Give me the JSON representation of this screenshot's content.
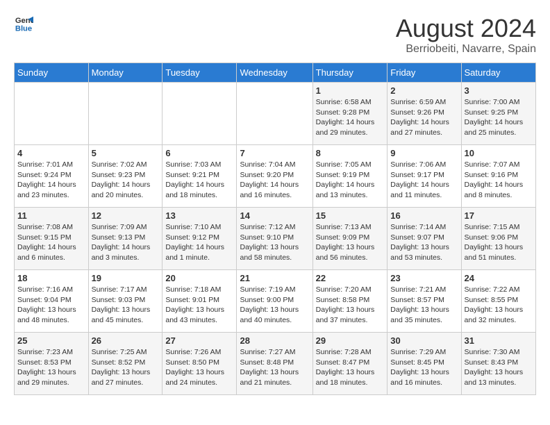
{
  "logo": {
    "text_general": "General",
    "text_blue": "Blue"
  },
  "header": {
    "month_year": "August 2024",
    "location": "Berriobeiti, Navarre, Spain"
  },
  "weekdays": [
    "Sunday",
    "Monday",
    "Tuesday",
    "Wednesday",
    "Thursday",
    "Friday",
    "Saturday"
  ],
  "weeks": [
    [
      {
        "day": "",
        "sunrise": "",
        "sunset": "",
        "daylight": ""
      },
      {
        "day": "",
        "sunrise": "",
        "sunset": "",
        "daylight": ""
      },
      {
        "day": "",
        "sunrise": "",
        "sunset": "",
        "daylight": ""
      },
      {
        "day": "",
        "sunrise": "",
        "sunset": "",
        "daylight": ""
      },
      {
        "day": "1",
        "sunrise": "Sunrise: 6:58 AM",
        "sunset": "Sunset: 9:28 PM",
        "daylight": "Daylight: 14 hours and 29 minutes."
      },
      {
        "day": "2",
        "sunrise": "Sunrise: 6:59 AM",
        "sunset": "Sunset: 9:26 PM",
        "daylight": "Daylight: 14 hours and 27 minutes."
      },
      {
        "day": "3",
        "sunrise": "Sunrise: 7:00 AM",
        "sunset": "Sunset: 9:25 PM",
        "daylight": "Daylight: 14 hours and 25 minutes."
      }
    ],
    [
      {
        "day": "4",
        "sunrise": "Sunrise: 7:01 AM",
        "sunset": "Sunset: 9:24 PM",
        "daylight": "Daylight: 14 hours and 23 minutes."
      },
      {
        "day": "5",
        "sunrise": "Sunrise: 7:02 AM",
        "sunset": "Sunset: 9:23 PM",
        "daylight": "Daylight: 14 hours and 20 minutes."
      },
      {
        "day": "6",
        "sunrise": "Sunrise: 7:03 AM",
        "sunset": "Sunset: 9:21 PM",
        "daylight": "Daylight: 14 hours and 18 minutes."
      },
      {
        "day": "7",
        "sunrise": "Sunrise: 7:04 AM",
        "sunset": "Sunset: 9:20 PM",
        "daylight": "Daylight: 14 hours and 16 minutes."
      },
      {
        "day": "8",
        "sunrise": "Sunrise: 7:05 AM",
        "sunset": "Sunset: 9:19 PM",
        "daylight": "Daylight: 14 hours and 13 minutes."
      },
      {
        "day": "9",
        "sunrise": "Sunrise: 7:06 AM",
        "sunset": "Sunset: 9:17 PM",
        "daylight": "Daylight: 14 hours and 11 minutes."
      },
      {
        "day": "10",
        "sunrise": "Sunrise: 7:07 AM",
        "sunset": "Sunset: 9:16 PM",
        "daylight": "Daylight: 14 hours and 8 minutes."
      }
    ],
    [
      {
        "day": "11",
        "sunrise": "Sunrise: 7:08 AM",
        "sunset": "Sunset: 9:15 PM",
        "daylight": "Daylight: 14 hours and 6 minutes."
      },
      {
        "day": "12",
        "sunrise": "Sunrise: 7:09 AM",
        "sunset": "Sunset: 9:13 PM",
        "daylight": "Daylight: 14 hours and 3 minutes."
      },
      {
        "day": "13",
        "sunrise": "Sunrise: 7:10 AM",
        "sunset": "Sunset: 9:12 PM",
        "daylight": "Daylight: 14 hours and 1 minute."
      },
      {
        "day": "14",
        "sunrise": "Sunrise: 7:12 AM",
        "sunset": "Sunset: 9:10 PM",
        "daylight": "Daylight: 13 hours and 58 minutes."
      },
      {
        "day": "15",
        "sunrise": "Sunrise: 7:13 AM",
        "sunset": "Sunset: 9:09 PM",
        "daylight": "Daylight: 13 hours and 56 minutes."
      },
      {
        "day": "16",
        "sunrise": "Sunrise: 7:14 AM",
        "sunset": "Sunset: 9:07 PM",
        "daylight": "Daylight: 13 hours and 53 minutes."
      },
      {
        "day": "17",
        "sunrise": "Sunrise: 7:15 AM",
        "sunset": "Sunset: 9:06 PM",
        "daylight": "Daylight: 13 hours and 51 minutes."
      }
    ],
    [
      {
        "day": "18",
        "sunrise": "Sunrise: 7:16 AM",
        "sunset": "Sunset: 9:04 PM",
        "daylight": "Daylight: 13 hours and 48 minutes."
      },
      {
        "day": "19",
        "sunrise": "Sunrise: 7:17 AM",
        "sunset": "Sunset: 9:03 PM",
        "daylight": "Daylight: 13 hours and 45 minutes."
      },
      {
        "day": "20",
        "sunrise": "Sunrise: 7:18 AM",
        "sunset": "Sunset: 9:01 PM",
        "daylight": "Daylight: 13 hours and 43 minutes."
      },
      {
        "day": "21",
        "sunrise": "Sunrise: 7:19 AM",
        "sunset": "Sunset: 9:00 PM",
        "daylight": "Daylight: 13 hours and 40 minutes."
      },
      {
        "day": "22",
        "sunrise": "Sunrise: 7:20 AM",
        "sunset": "Sunset: 8:58 PM",
        "daylight": "Daylight: 13 hours and 37 minutes."
      },
      {
        "day": "23",
        "sunrise": "Sunrise: 7:21 AM",
        "sunset": "Sunset: 8:57 PM",
        "daylight": "Daylight: 13 hours and 35 minutes."
      },
      {
        "day": "24",
        "sunrise": "Sunrise: 7:22 AM",
        "sunset": "Sunset: 8:55 PM",
        "daylight": "Daylight: 13 hours and 32 minutes."
      }
    ],
    [
      {
        "day": "25",
        "sunrise": "Sunrise: 7:23 AM",
        "sunset": "Sunset: 8:53 PM",
        "daylight": "Daylight: 13 hours and 29 minutes."
      },
      {
        "day": "26",
        "sunrise": "Sunrise: 7:25 AM",
        "sunset": "Sunset: 8:52 PM",
        "daylight": "Daylight: 13 hours and 27 minutes."
      },
      {
        "day": "27",
        "sunrise": "Sunrise: 7:26 AM",
        "sunset": "Sunset: 8:50 PM",
        "daylight": "Daylight: 13 hours and 24 minutes."
      },
      {
        "day": "28",
        "sunrise": "Sunrise: 7:27 AM",
        "sunset": "Sunset: 8:48 PM",
        "daylight": "Daylight: 13 hours and 21 minutes."
      },
      {
        "day": "29",
        "sunrise": "Sunrise: 7:28 AM",
        "sunset": "Sunset: 8:47 PM",
        "daylight": "Daylight: 13 hours and 18 minutes."
      },
      {
        "day": "30",
        "sunrise": "Sunrise: 7:29 AM",
        "sunset": "Sunset: 8:45 PM",
        "daylight": "Daylight: 13 hours and 16 minutes."
      },
      {
        "day": "31",
        "sunrise": "Sunrise: 7:30 AM",
        "sunset": "Sunset: 8:43 PM",
        "daylight": "Daylight: 13 hours and 13 minutes."
      }
    ]
  ]
}
